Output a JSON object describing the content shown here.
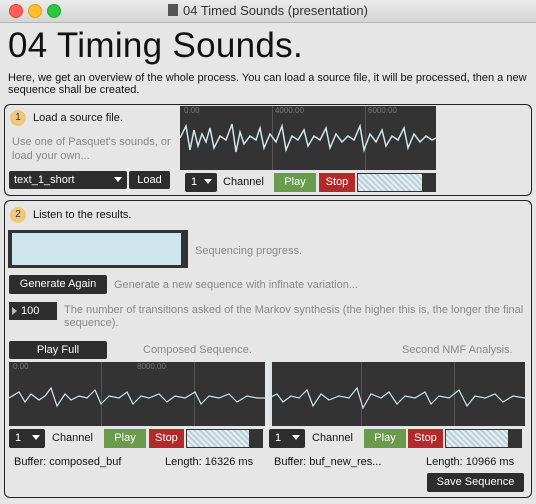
{
  "window": {
    "title": "04 Timed Sounds (presentation)"
  },
  "header": {
    "title": "04 Timing Sounds.",
    "intro": "Here, we get an overview of the whole process. You can load a source file, it will be processed, then a new sequence shall be created."
  },
  "step1": {
    "number": "1",
    "label": "Load a source file.",
    "hint": "Use one of Pasquet's sounds, or load your own...",
    "file_select": "text_1_short",
    "load_label": "Load",
    "wave_ticks": [
      "0.00",
      "4000.00",
      "6000.00"
    ],
    "channel_value": "1",
    "channel_label": "Channel",
    "play_label": "Play",
    "stop_label": "Stop"
  },
  "step2": {
    "number": "2",
    "label": "Listen to the results.",
    "progress_label": "Sequencing progress.",
    "progress_fraction": 0.98,
    "generate_label": "Generate Again",
    "generate_hint": "Generate a new sequence with infinate variation...",
    "transitions_value": "100",
    "transitions_hint": "The number of transitions asked of the Markov synthesis (the higher this is, the longer the final sequence).",
    "play_full_label": "Play Full",
    "composed_caption": "Composed Sequence.",
    "nmf_caption": "Second NMF Analysis.",
    "left": {
      "wave_ticks": [
        "0.00",
        "8000.00"
      ],
      "channel_value": "1",
      "channel_label": "Channel",
      "play_label": "Play",
      "stop_label": "Stop",
      "buffer": "Buffer: composed_buf",
      "length": "Length: 16326 ms"
    },
    "right": {
      "channel_value": "1",
      "channel_label": "Channel",
      "play_label": "Play",
      "stop_label": "Stop",
      "buffer": "Buffer: buf_new_res...",
      "length": "Length: 10966 ms"
    },
    "save_label": "Save Sequence"
  },
  "colors": {
    "accent_badge": "#f2c77c",
    "play": "#6a9b4c",
    "stop": "#b32a2a",
    "wave": "#cfe6ec",
    "panel_bg": "#333333"
  }
}
